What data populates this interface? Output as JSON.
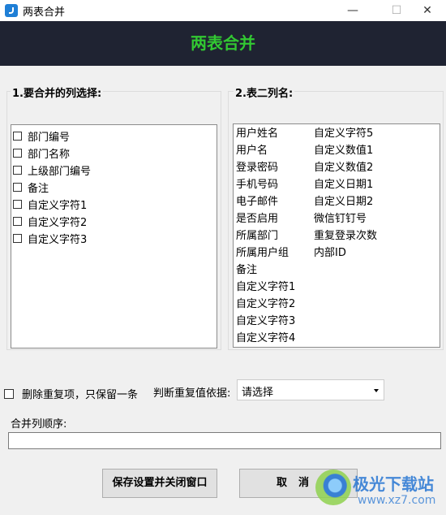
{
  "window": {
    "title": "两表合并",
    "min_glyph": "—",
    "max_glyph": "☐",
    "close_glyph": "✕"
  },
  "header": {
    "title": "两表合并"
  },
  "merge_columns": {
    "title": "1.要合并的列选择:",
    "items": [
      {
        "label": "部门编号",
        "checked": false
      },
      {
        "label": "部门名称",
        "checked": false
      },
      {
        "label": "上级部门编号",
        "checked": false
      },
      {
        "label": "备注",
        "checked": false
      },
      {
        "label": "自定义字符1",
        "checked": false
      },
      {
        "label": "自定义字符2",
        "checked": false
      },
      {
        "label": "自定义字符3",
        "checked": false
      }
    ]
  },
  "table2_columns": {
    "title": "2.表二列名:",
    "col1": [
      "用户姓名",
      "用户名",
      "登录密码",
      "手机号码",
      "电子邮件",
      "是否启用",
      "所属部门",
      "所属用户组",
      "备注",
      "自定义字符1",
      "自定义字符2",
      "自定义字符3",
      "自定义字符4"
    ],
    "col2": [
      "自定义字符5",
      "自定义数值1",
      "自定义数值2",
      "自定义日期1",
      "自定义日期2",
      "微信钉钉号",
      "重复登录次数",
      "内部ID"
    ]
  },
  "options": {
    "dedupe_label": "删除重复项，只保留一条",
    "dedupe_checked": false,
    "criteria_label": "判断重复值依据:",
    "criteria_value": "请选择"
  },
  "order": {
    "label": "合并列顺序:",
    "value": ""
  },
  "buttons": {
    "save": "保存设置并关闭窗口",
    "cancel": "取消"
  },
  "watermark": {
    "line1": "极光下载站",
    "line2": "www.xz7.com"
  },
  "colors": {
    "header_bg": "#1f2332",
    "header_text": "#32c832",
    "app_icon": "#1f7fd6"
  }
}
